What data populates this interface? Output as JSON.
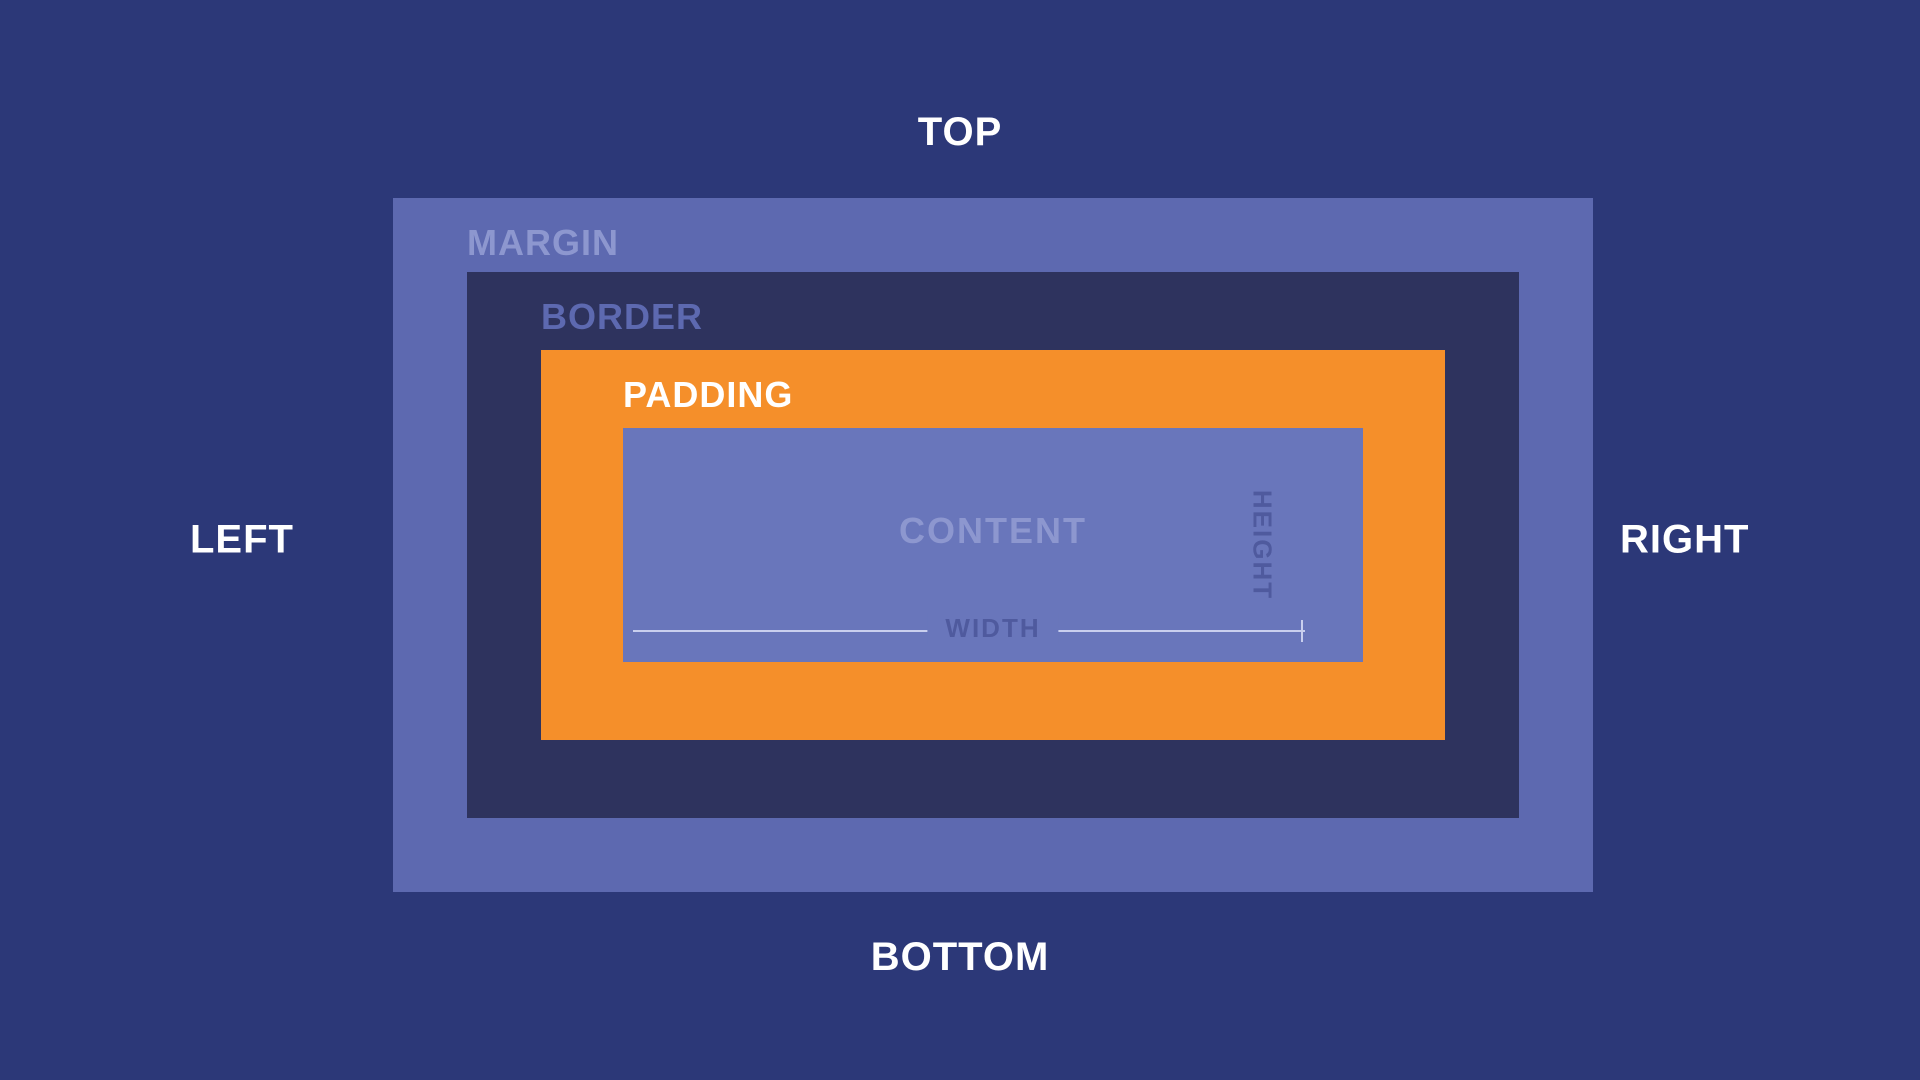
{
  "directions": {
    "top": "TOP",
    "bottom": "BOTTOM",
    "left": "LEFT",
    "right": "RIGHT"
  },
  "box": {
    "margin": "MARGIN",
    "border": "BORDER",
    "padding": "PADDING",
    "content": "CONTENT",
    "width": "WIDTH",
    "height": "HEIGHT"
  },
  "colors": {
    "background": "#2c3878",
    "margin": "#5d69b0",
    "border": "#2e335e",
    "padding": "#f58f2a",
    "content": "#6976bb"
  }
}
